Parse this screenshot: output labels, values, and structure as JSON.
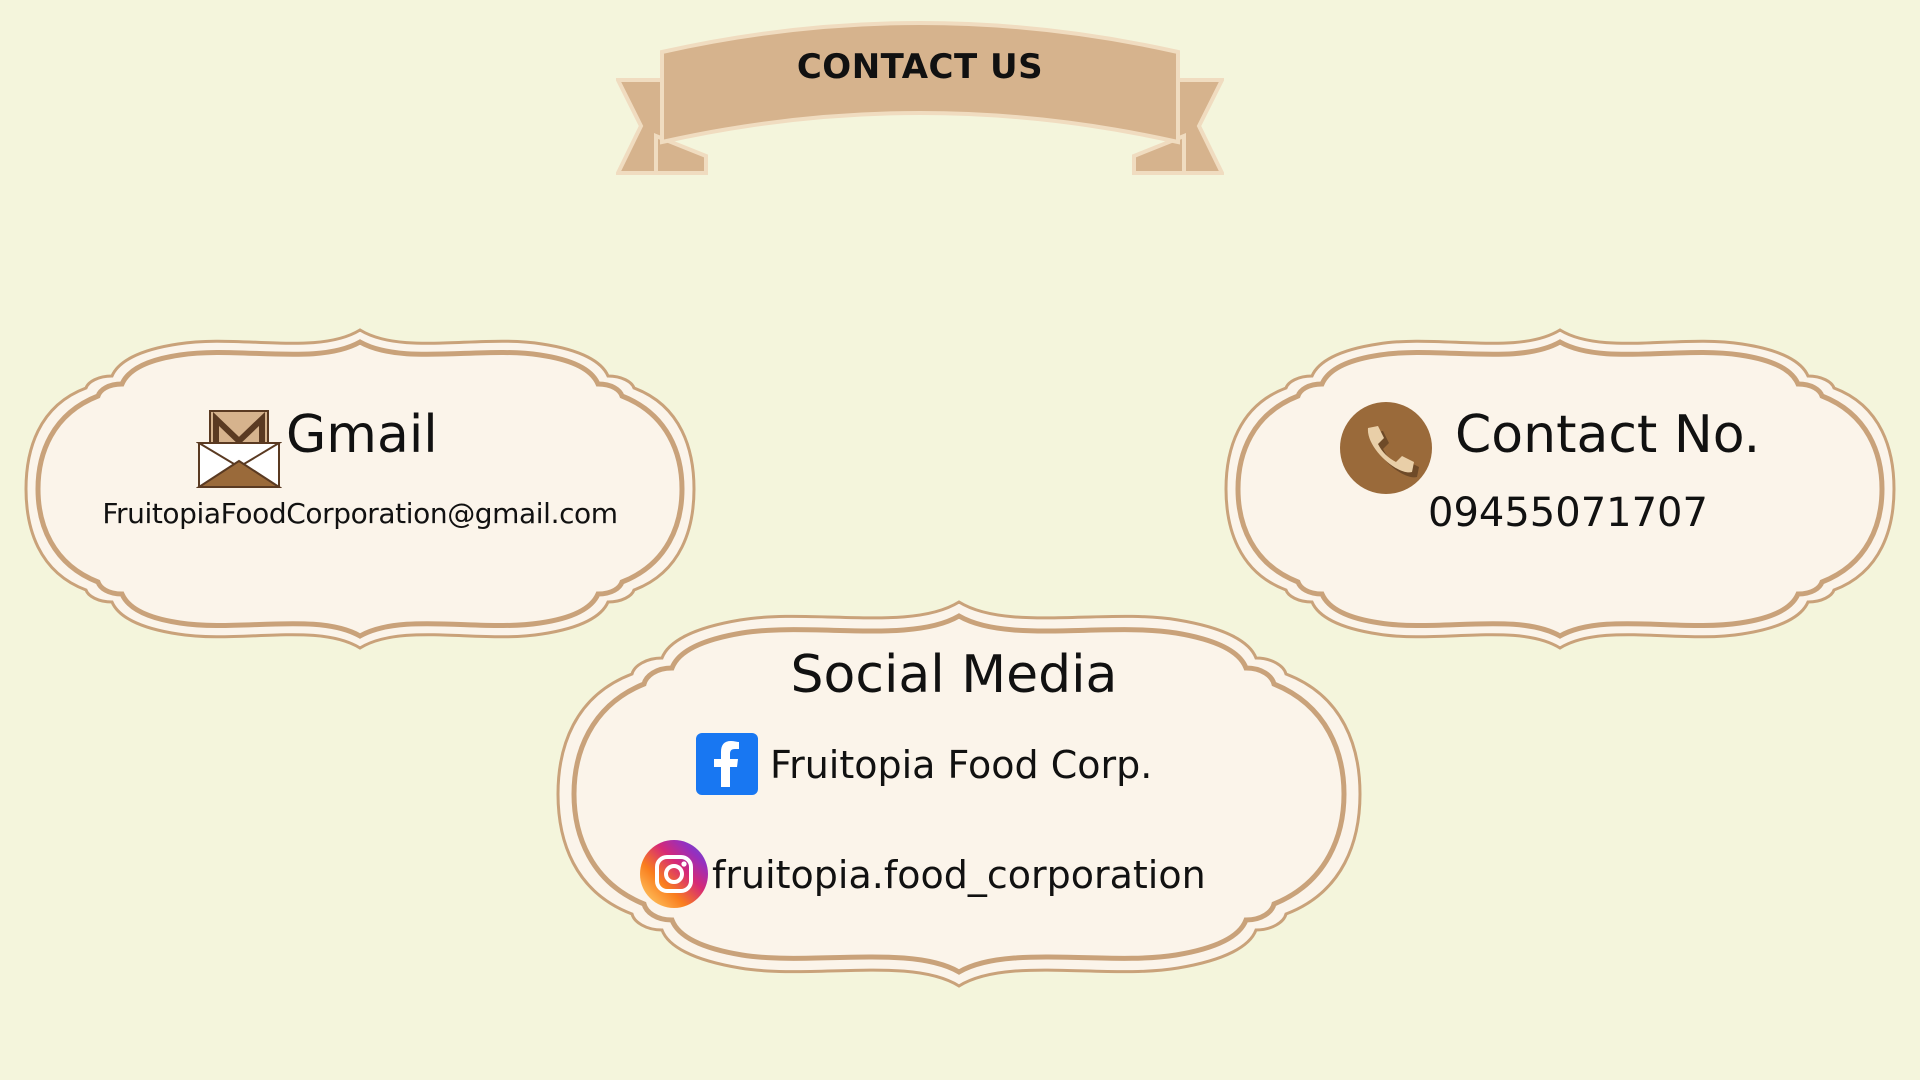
{
  "banner": {
    "title": "CONTACT US"
  },
  "gmail": {
    "title": "Gmail",
    "value": "FruitopiaFoodCorporation@gmail.com",
    "icon": "envelope-icon"
  },
  "contact": {
    "title": "Contact No.",
    "value": "09455071707",
    "icon": "phone-icon"
  },
  "social": {
    "title": "Social Media",
    "facebook": {
      "label": "Fruitopia Food Corp.",
      "icon": "facebook-icon"
    },
    "instagram": {
      "label": "fruitopia.food_corporation",
      "icon": "instagram-icon"
    }
  },
  "colors": {
    "background": "#f4f5dc",
    "ribbon": "#d6b38d",
    "ribbon_border": "#f0dcc0",
    "frame_fill": "#fbf4ea",
    "frame_stroke": "#c9a27a",
    "phone_circle": "#9a6a3a",
    "facebook": "#1877f2"
  }
}
